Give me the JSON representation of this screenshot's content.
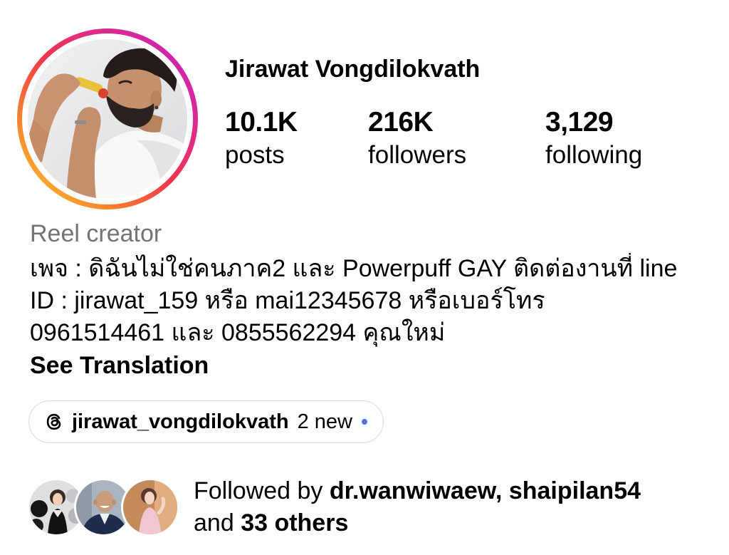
{
  "profile": {
    "name": "Jirawat Vongdilokvath",
    "category": "Reel creator"
  },
  "stats": [
    {
      "value": "10.1K",
      "label": "posts"
    },
    {
      "value": "216K",
      "label": "followers"
    },
    {
      "value": "3,129",
      "label": "following"
    }
  ],
  "bio": {
    "lines": [
      "เพจ : ดิฉันไม่ใช่คนภาค2 และ Powerpuff GAY ติดต่องานที่ line",
      "ID : jirawat_159 หรือ mai12345678 หรือเบอร์โทร",
      "0961514461 และ 0855562294 คุณใหม่"
    ],
    "see_translation": "See Translation"
  },
  "threads": {
    "icon": "threads-icon",
    "handle": "jirawat_vongdilokvath",
    "new_label": "2 new"
  },
  "followed_by": {
    "prefix": "Followed by",
    "users": [
      "dr.wanwiwaew",
      "shaipilan54"
    ],
    "separator": ",",
    "conjunction": "and",
    "others": "33 others"
  },
  "colors": {
    "text": "#000000",
    "secondary_text": "#737373",
    "new_dot": "#5b6cf2",
    "pill_border": "#dbdbdb",
    "story_ring": [
      "#fcd33a",
      "#f7852a",
      "#f0354e",
      "#d92a95",
      "#c21cc4"
    ]
  }
}
